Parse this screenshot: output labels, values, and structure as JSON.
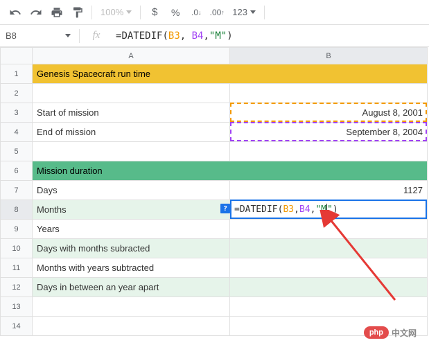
{
  "toolbar": {
    "zoom": "100%",
    "num_format": "123"
  },
  "name_box": "B8",
  "formula": {
    "prefix": "=",
    "fn": "DATEDIF",
    "open": "(",
    "ref1": "B3",
    "sep": ", ",
    "ref2": "B4",
    "sep2": ",",
    "str": "\"M\"",
    "close": ")"
  },
  "columns": [
    "A",
    "B"
  ],
  "rows": [
    {
      "n": 1,
      "a": "Genesis Spacecraft run time",
      "b": "",
      "class": "header-yellow",
      "merge": true
    },
    {
      "n": 2,
      "a": "",
      "b": ""
    },
    {
      "n": 3,
      "a": "Start of mission",
      "b": "August 8, 2001",
      "b_right": true
    },
    {
      "n": 4,
      "a": "End of mission",
      "b": "September 8, 2004",
      "b_right": true
    },
    {
      "n": 5,
      "a": "",
      "b": ""
    },
    {
      "n": 6,
      "a": "Mission duration",
      "b": "",
      "class": "header-green",
      "merge": true
    },
    {
      "n": 7,
      "a": "Days",
      "b": "1127",
      "b_right": true
    },
    {
      "n": 8,
      "a": "Months",
      "b": "",
      "alt": true
    },
    {
      "n": 9,
      "a": "Years",
      "b": ""
    },
    {
      "n": 10,
      "a": "Days with months subracted",
      "b": "",
      "alt": true
    },
    {
      "n": 11,
      "a": "Months with years subtracted",
      "b": ""
    },
    {
      "n": 12,
      "a": "Days in between an year apart",
      "b": "",
      "alt": true
    },
    {
      "n": 13,
      "a": "",
      "b": ""
    },
    {
      "n": 14,
      "a": "",
      "b": ""
    }
  ],
  "active_cell_formula": {
    "prefix": "=DATEDIF(",
    "ref1": "B3",
    "sep": ", ",
    "ref2": "B4",
    "sep2": ",",
    "str_open": "\"M",
    "str_close": "\"",
    "close": ")"
  },
  "watermark": {
    "badge": "php",
    "text": "中文网"
  }
}
